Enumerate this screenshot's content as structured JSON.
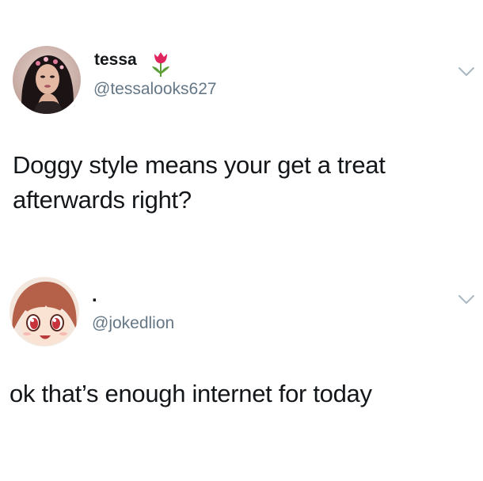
{
  "tweets": [
    {
      "display_name": "tessa",
      "display_name_emoji": "tulip-icon",
      "handle": "@tessalooks627",
      "text": "Doggy style means your get a treat afterwards right?"
    },
    {
      "display_name": ".",
      "handle": "@jokedlion",
      "text": "ok that’s enough internet for today"
    }
  ],
  "colors": {
    "text": "#14171a",
    "handle": "#657786",
    "chevron": "#aab8c2",
    "tulip_red": "#e0245e",
    "tulip_leaf": "#5d9e37"
  }
}
